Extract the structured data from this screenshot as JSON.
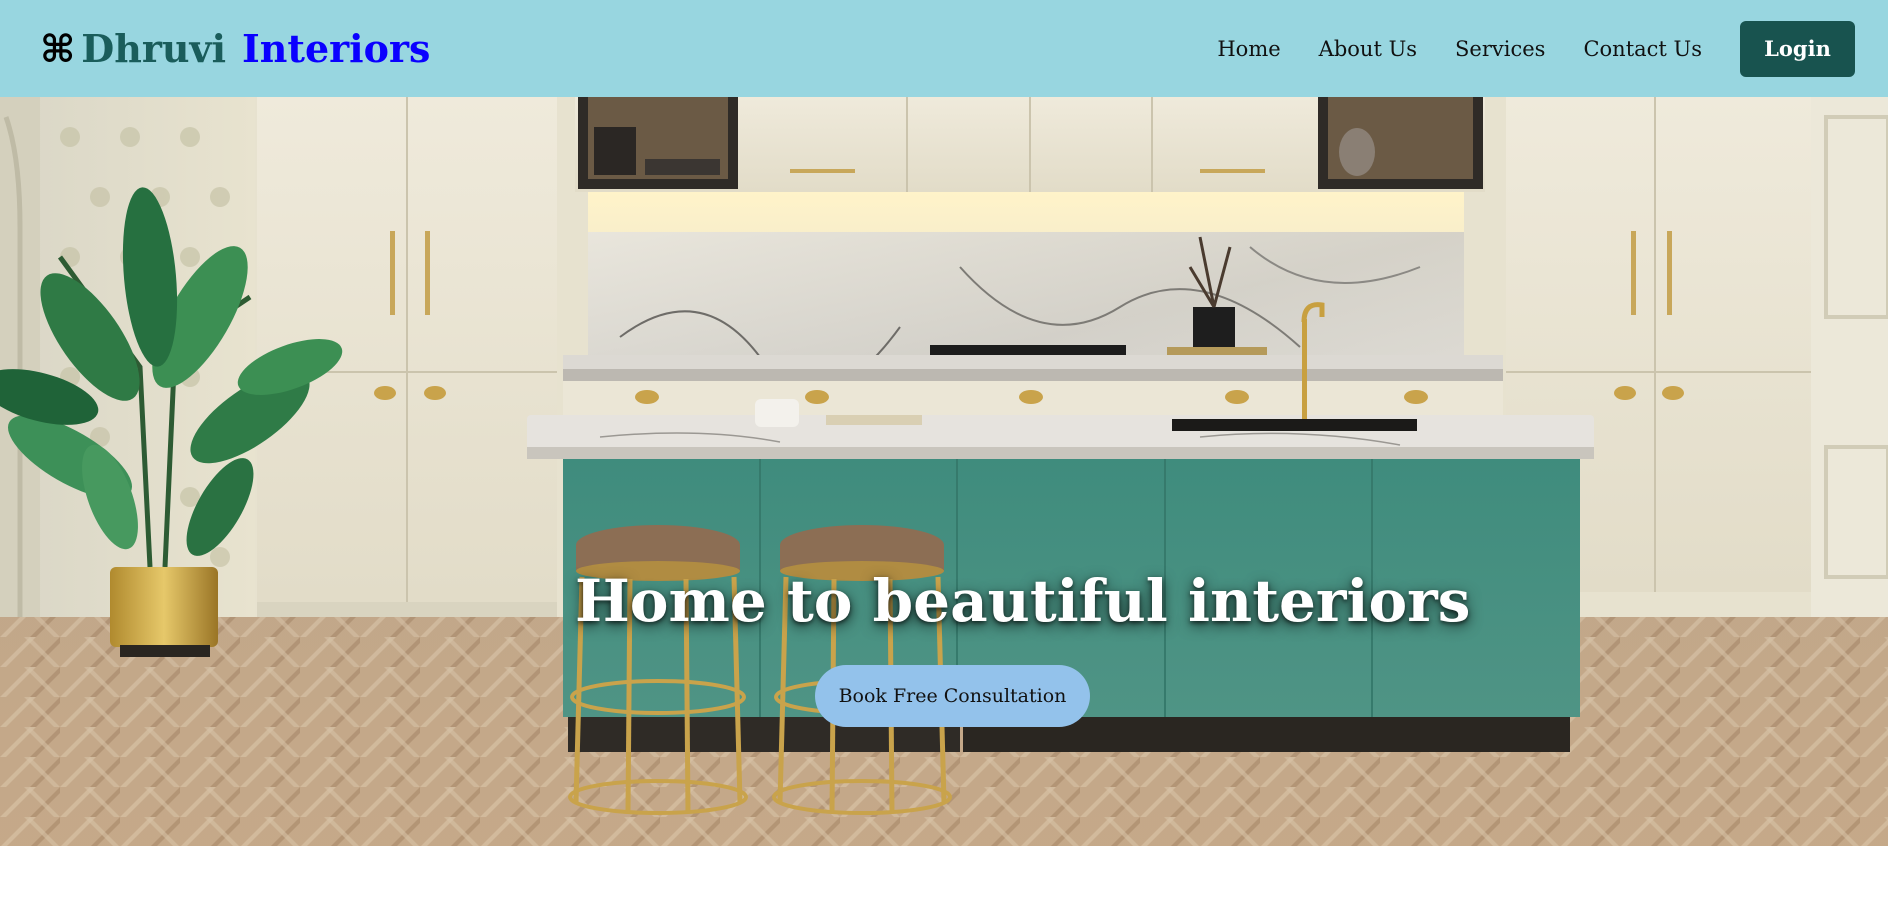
{
  "brand": {
    "icon": "⌘",
    "part1": "Dhruvi",
    "part2": "Interiors"
  },
  "nav": {
    "items": [
      {
        "label": "Home"
      },
      {
        "label": "About Us"
      },
      {
        "label": "Services"
      },
      {
        "label": "Contact Us"
      }
    ],
    "login_label": "Login"
  },
  "hero": {
    "heading": "Home to beautiful interiors",
    "cta_label": "Book Free Consultation",
    "image_subject": "luxury kitchen with teal island, brass stools, cream cabinets and herringbone floor"
  },
  "colors": {
    "header_bg": "#98d6e0",
    "brand_dark": "#1a5d5b",
    "brand_blue": "#0a00ff",
    "login_bg": "#18534f",
    "cta_bg": "#93c2eb"
  }
}
